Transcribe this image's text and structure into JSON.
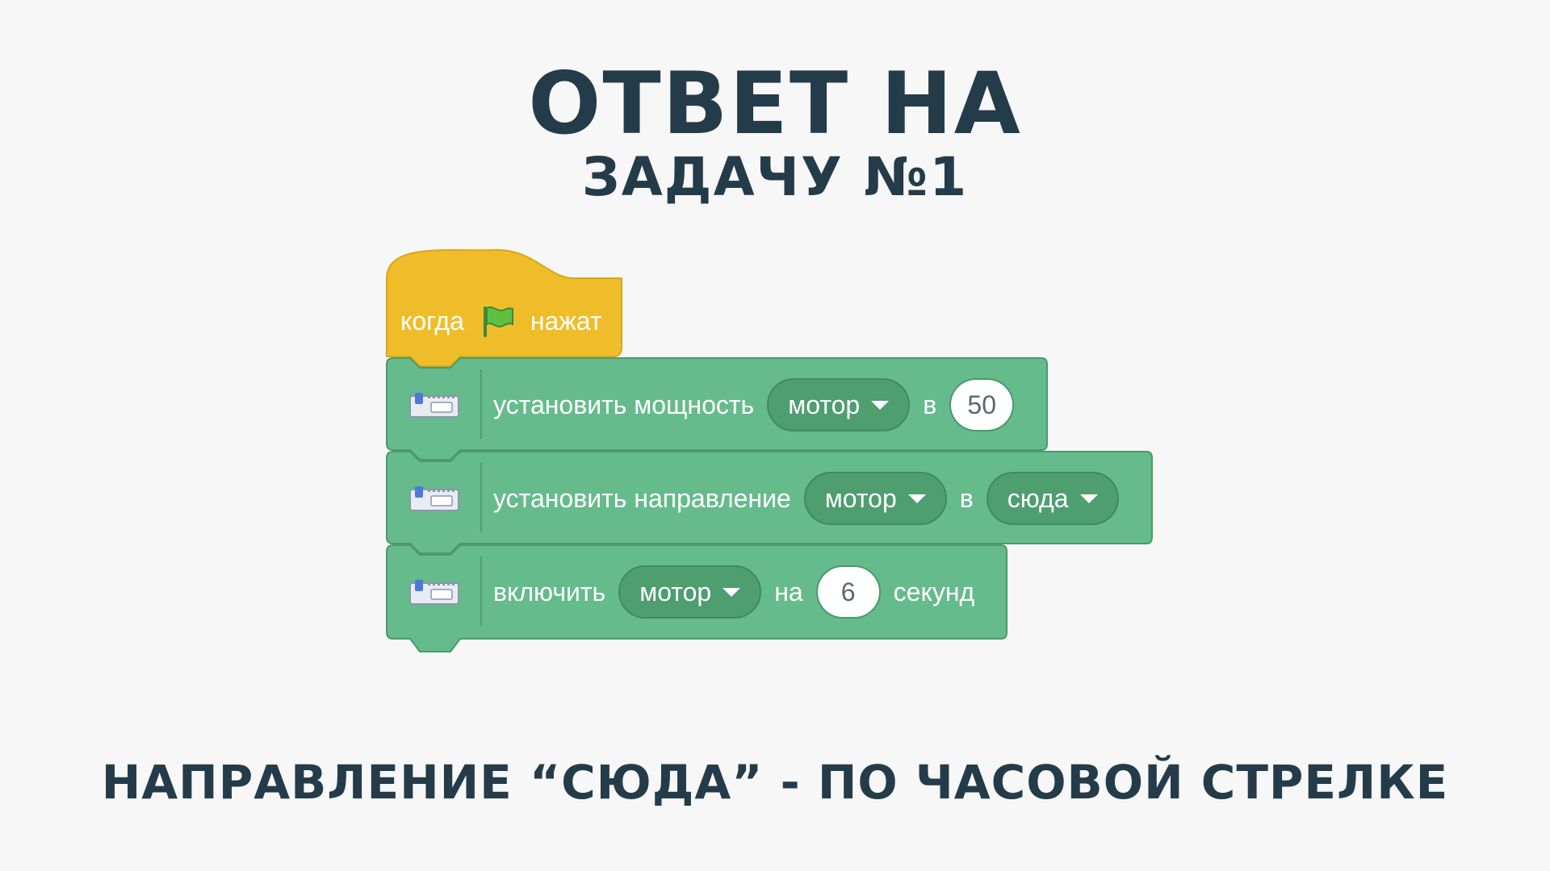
{
  "title": "ОТВЕТ НА",
  "subtitle": "ЗАДАЧУ №1",
  "footer": "НАПРАВЛЕНИЕ “СЮДА” - ПО ЧАСОВОЙ СТРЕЛКЕ",
  "colors": {
    "heading": "#243b4a",
    "hat_block": "#f0bd2a",
    "motion_block": "#66bb8c",
    "dropdown": "#4e9e70",
    "background": "#f7f7f7"
  },
  "script": {
    "hat": {
      "label_before": "когда",
      "icon": "green-flag-icon",
      "label_after": "нажат"
    },
    "blocks": [
      {
        "icon": "motor-extension-icon",
        "label": "установить мощность",
        "motor_dropdown": "мотор",
        "connector": "в",
        "power_value": "50"
      },
      {
        "icon": "motor-extension-icon",
        "label": "установить направление",
        "motor_dropdown": "мотор",
        "connector": "в",
        "direction_dropdown": "сюда"
      },
      {
        "icon": "motor-extension-icon",
        "label": "включить",
        "motor_dropdown": "мотор",
        "connector": "на",
        "seconds_value": "6",
        "unit": "секунд"
      }
    ]
  }
}
